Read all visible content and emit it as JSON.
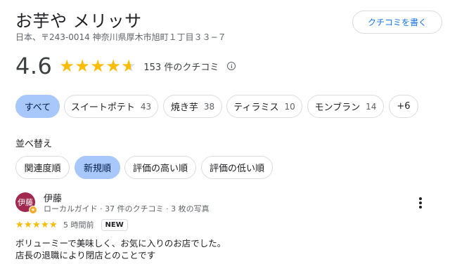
{
  "place": {
    "title": "お芋や メリッサ",
    "address": "日本、〒243-0014 神奈川県厚木市旭町１丁目３３−７",
    "write_review_label": "クチコミを書く"
  },
  "rating": {
    "value": "4.6",
    "value_numeric": 4.6,
    "count_text": "153 件のクチコミ",
    "info_icon": "info-icon"
  },
  "topic_chips": [
    {
      "label": "すべて",
      "count": "",
      "selected": true
    },
    {
      "label": "スイートポテト",
      "count": "43",
      "selected": false
    },
    {
      "label": "焼き芋",
      "count": "38",
      "selected": false
    },
    {
      "label": "ティラミス",
      "count": "10",
      "selected": false
    },
    {
      "label": "モンブラン",
      "count": "14",
      "selected": false
    },
    {
      "label": "+6",
      "count": "",
      "selected": false
    }
  ],
  "sort": {
    "label": "並べ替え",
    "options": [
      {
        "label": "関連度順",
        "selected": false
      },
      {
        "label": "新規順",
        "selected": true
      },
      {
        "label": "評価の高い順",
        "selected": false
      },
      {
        "label": "評価の低い順",
        "selected": false
      }
    ]
  },
  "review": {
    "avatar_text": "伊藤",
    "avatar_color": "#a1284e",
    "name": "伊藤",
    "meta": "ローカルガイド · 37 件のクチコミ · 3 枚の写真",
    "stars": 5,
    "time": "5 時間前",
    "badge": "NEW",
    "text_line1": "ボリューミーで美味しく、お気に入りのお店でした。",
    "text_line2": "店長の退職により閉店とのことです"
  },
  "colors": {
    "accent": "#1a73e8",
    "selected_chip": "#a8c7fa",
    "star": "#fbbc04"
  }
}
